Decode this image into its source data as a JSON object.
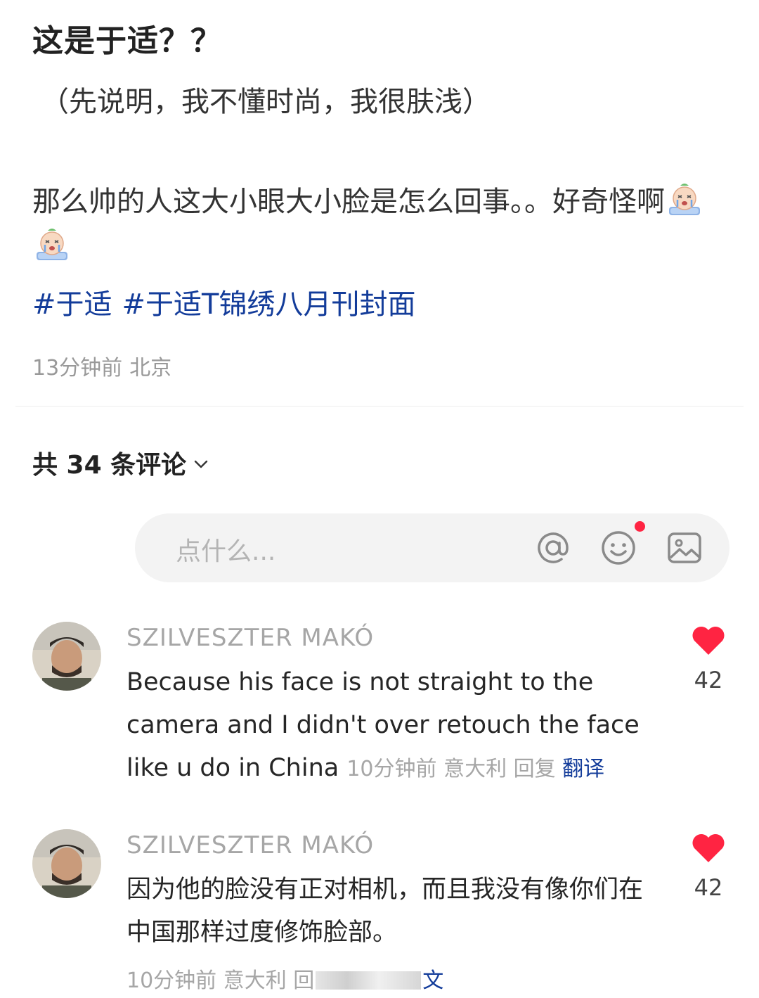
{
  "post": {
    "title": "这是于适？？",
    "subnote": "（先说明，我不懂时尚，我很肤浅）",
    "body_text": "那么帅的人这大小眼大小脸是怎么回事。。好奇怪啊",
    "emojis": [
      "crying-emoji",
      "crying-emoji"
    ],
    "hashtags": [
      "#于适",
      "#于适T锦绣八月刊封面"
    ],
    "time": "13分钟前",
    "location": "北京"
  },
  "comments_header": {
    "label": "共 34 条评论"
  },
  "input_bar": {
    "placeholder": "点什么...",
    "icons": [
      "at-icon",
      "smile-icon",
      "image-icon"
    ]
  },
  "comments": [
    {
      "author": "SZILVESZTER MAKÓ",
      "text": "Because his face is not straight to the camera and I didn't over retouch the face like u do in China",
      "time": "10分钟前",
      "location": "意大利",
      "reply": "回复",
      "translate": "翻译",
      "likes": "42"
    },
    {
      "author": "SZILVESZTER MAKÓ",
      "text": "因为他的脸没有正对相机，而且我没有像你们在中国那样过度修饰脸部。",
      "time": "10分钟前",
      "location": "意大利",
      "reply": "回",
      "translate": "文",
      "likes": "42"
    }
  ],
  "colors": {
    "link": "#133c9a",
    "like_heart": "#ff2442",
    "meta_gray": "#a6a6a6"
  }
}
